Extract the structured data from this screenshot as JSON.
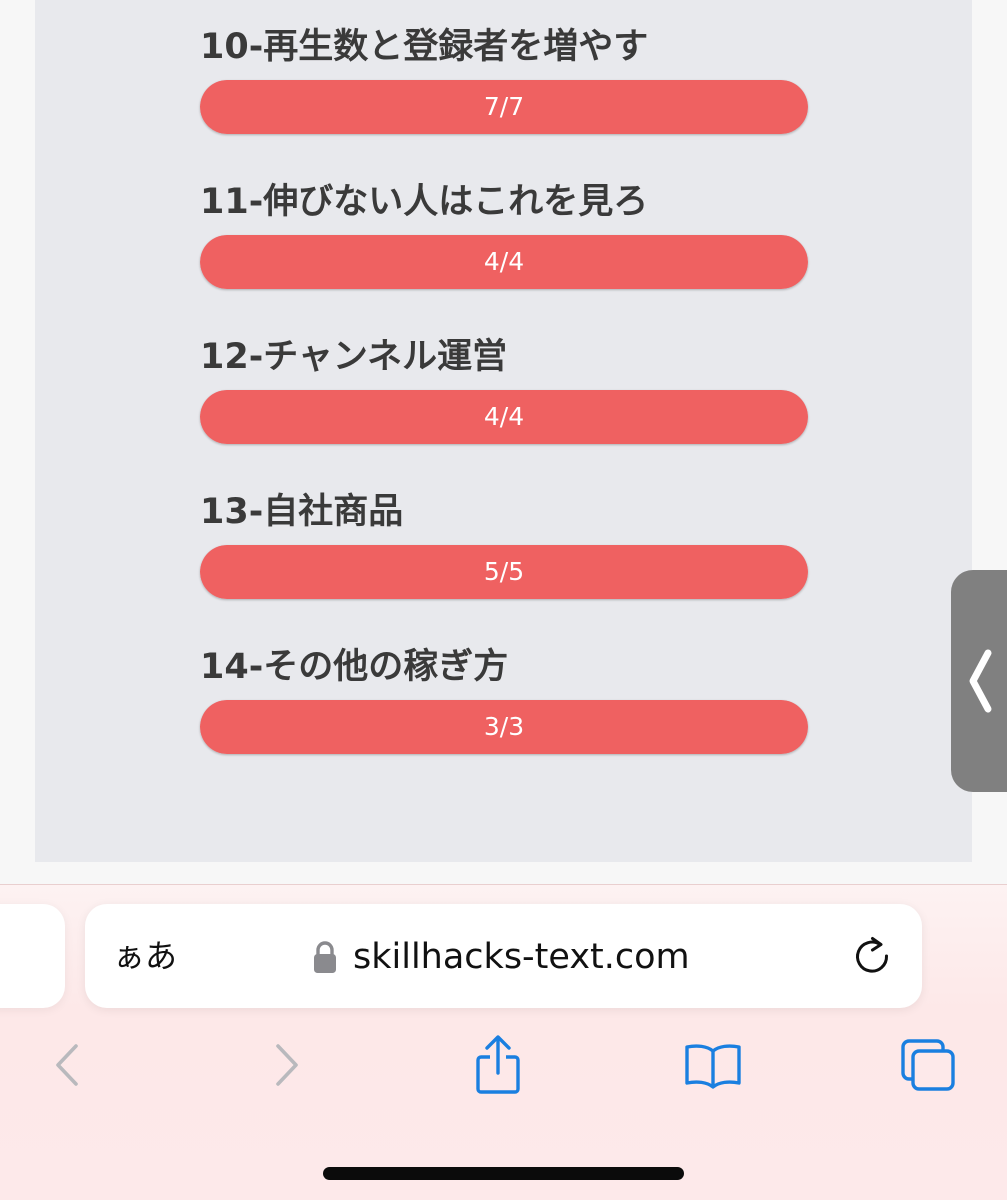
{
  "lessons": [
    {
      "title": "10-再生数と登録者を増やす",
      "progress_text": "7/7",
      "progress": 1.0
    },
    {
      "title": "11-伸びない人はこれを見ろ",
      "progress_text": "4/4",
      "progress": 1.0
    },
    {
      "title": "12-チャンネル運営",
      "progress_text": "4/4",
      "progress": 1.0
    },
    {
      "title": "13-自社商品",
      "progress_text": "5/5",
      "progress": 1.0
    },
    {
      "title": "14-その他の稼ぎ方",
      "progress_text": "3/3",
      "progress": 1.0
    }
  ],
  "browser": {
    "text_size_label": "ぁあ",
    "url": "skillhacks-text.com"
  },
  "icons": {
    "side_handle": "chevron-left-icon",
    "lock": "lock-icon",
    "reload": "reload-icon",
    "back": "back-icon",
    "forward": "forward-icon",
    "share": "share-icon",
    "bookmarks": "bookmarks-icon",
    "tabs": "tabs-icon"
  },
  "colors": {
    "progress_fill": "#ef6161",
    "accent": "#1a7fe0",
    "disabled": "#b9b9bd"
  }
}
